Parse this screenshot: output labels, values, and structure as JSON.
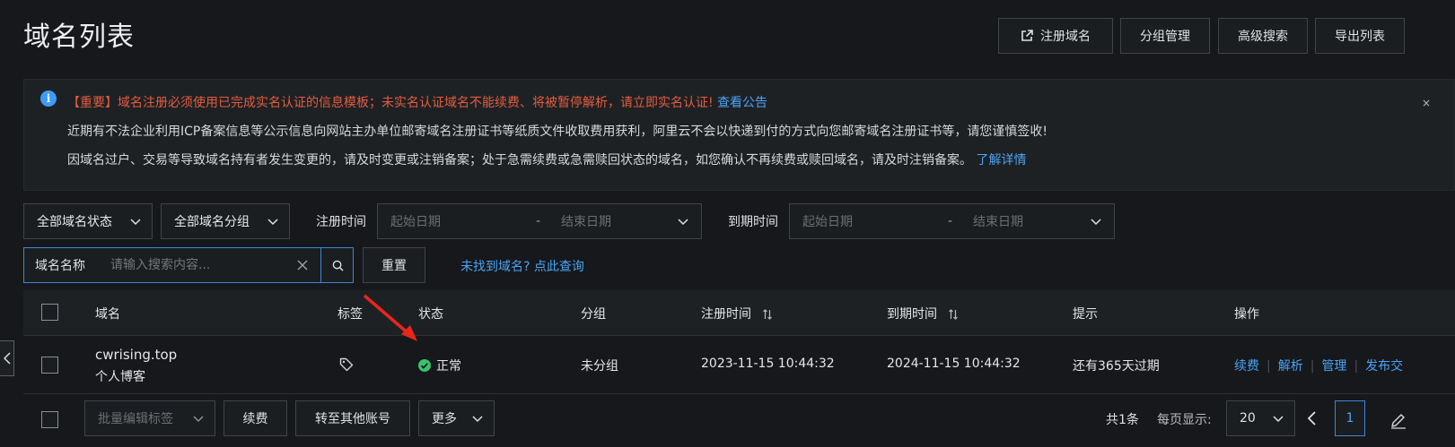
{
  "page": {
    "title": "域名列表"
  },
  "header_buttons": {
    "register": "注册域名",
    "group_manage": "分组管理",
    "advanced_search": "高级搜索",
    "export": "导出列表"
  },
  "notice": {
    "line1_text": "【重要】域名注册必须使用已完成实名认证的信息模板；未实名认证域名不能续费、将被暂停解析，请立即实名认证!",
    "line1_link": "查看公告",
    "line2_text": "近期有不法企业利用ICP备案信息等公示信息向网站主办单位邮寄域名注册证书等纸质文件收取费用获利，阿里云不会以快递到付的方式向您邮寄域名注册证书等，请您谨慎签收!",
    "line3_text": "因域名过户、交易等导致域名持有者发生变更的，请及时变更或注销备案；处于急需续费或急需赎回状态的域名，如您确认不再续费或赎回域名，请及时注销备案。",
    "line3_link": "了解详情",
    "close": "×"
  },
  "filters": {
    "status_select": "全部域名状态",
    "group_select": "全部域名分组",
    "reg_time_label": "注册时间",
    "reg_start_placeholder": "起始日期",
    "reg_end_placeholder": "结束日期",
    "exp_time_label": "到期时间",
    "exp_start_placeholder": "起始日期",
    "exp_end_placeholder": "结束日期",
    "date_sep": "-",
    "search_field_label": "域名名称",
    "search_placeholder": "请输入搜索内容...",
    "reset": "重置",
    "not_found_link": "未找到域名? 点此查询"
  },
  "table": {
    "headers": {
      "domain": "域名",
      "tag": "标签",
      "status": "状态",
      "group": "分组",
      "reg_time": "注册时间",
      "exp_time": "到期时间",
      "tip": "提示",
      "actions": "操作"
    },
    "rows": [
      {
        "domain": "cwrising.top",
        "remark": "个人博客",
        "status": "正常",
        "group": "未分组",
        "reg_time": "2023-11-15 10:44:32",
        "exp_time": "2024-11-15 10:44:32",
        "tip": "还有365天过期",
        "actions": [
          "续费",
          "解析",
          "管理",
          "发布交"
        ]
      }
    ]
  },
  "footer": {
    "batch_tag": "批量编辑标签",
    "renew": "续费",
    "transfer": "转至其他账号",
    "more": "更多",
    "total": "共1条",
    "per_page_label": "每页显示:",
    "per_page_value": "20",
    "current_page": "1"
  },
  "colors": {
    "background": "#16181b",
    "link": "#4ba3f5",
    "warning": "#e35c3f",
    "success": "#35c36e",
    "annotation_arrow": "#e8261c"
  }
}
